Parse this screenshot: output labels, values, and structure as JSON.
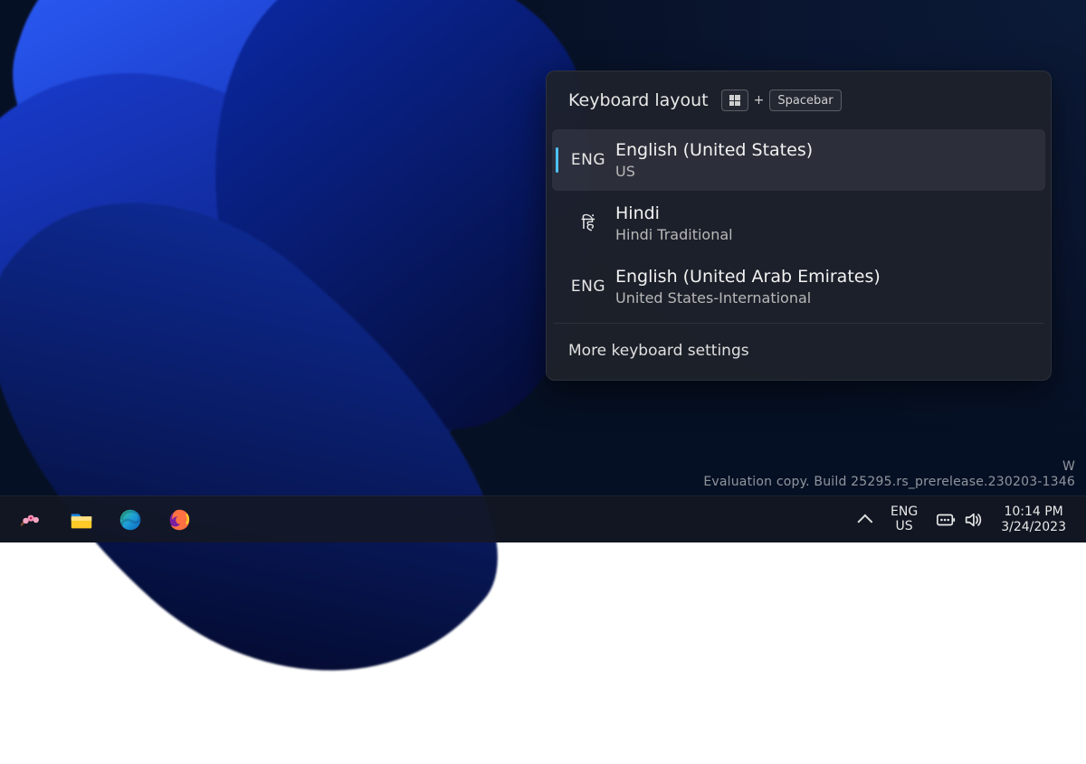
{
  "flyout": {
    "title": "Keyboard layout",
    "shortcut_plus": "+",
    "shortcut_key": "Spacebar",
    "more": "More keyboard settings",
    "layouts": [
      {
        "code": "ENG",
        "name": "English (United States)",
        "sub": "US",
        "selected": true
      },
      {
        "code": "हिं",
        "name": "Hindi",
        "sub": "Hindi Traditional",
        "selected": false
      },
      {
        "code": "ENG",
        "name": "English (United Arab Emirates)",
        "sub": "United States-International",
        "selected": false
      }
    ]
  },
  "watermark": {
    "line1": "W",
    "line2": "Evaluation copy. Build 25295.rs_prerelease.230203-1346"
  },
  "taskbar": {
    "ime_lang": "ENG",
    "ime_layout": "US",
    "time": "10:14 PM",
    "date": "3/24/2023"
  },
  "colors": {
    "accent": "#4cc2ff"
  }
}
